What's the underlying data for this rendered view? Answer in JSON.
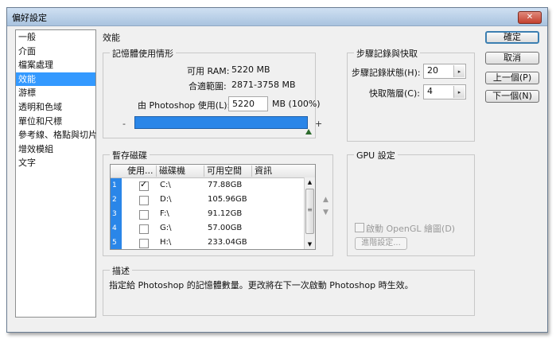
{
  "window": {
    "title": "偏好設定",
    "close_glyph": "✕"
  },
  "nav": {
    "items": [
      {
        "label": "一般"
      },
      {
        "label": "介面"
      },
      {
        "label": "檔案處理"
      },
      {
        "label": "效能",
        "selected": true
      },
      {
        "label": "游標"
      },
      {
        "label": "透明和色域"
      },
      {
        "label": "單位和尺標"
      },
      {
        "label": "參考線、格點與切片"
      },
      {
        "label": "增效模組"
      },
      {
        "label": "文字"
      }
    ]
  },
  "section_title": "效能",
  "memory": {
    "legend": "記憶體使用情形",
    "available_label": "可用 RAM:",
    "available_value": "5220 MB",
    "ideal_label": "合適範圍:",
    "ideal_value": "2871-3758 MB",
    "use_label": "由 Photoshop 使用(L):",
    "use_value": "5220",
    "use_unit": "MB (100%)",
    "minus": "-",
    "plus": "+",
    "usage_fraction": 1.0
  },
  "history": {
    "legend": "步驟記錄與快取",
    "states_label": "步驟記錄狀態(H):",
    "states_value": "20",
    "cache_label": "快取階層(C):",
    "cache_value": "4"
  },
  "buttons": {
    "ok": "確定",
    "cancel": "取消",
    "prev": "上一個(P)",
    "next": "下一個(N)"
  },
  "scratch": {
    "legend": "暫存磁碟",
    "headers": [
      "使用...",
      "磁碟機",
      "可用空間",
      "資訊"
    ],
    "rows": [
      {
        "num": "1",
        "checked": true,
        "drive": "C:\\",
        "free": "77.88GB",
        "info": ""
      },
      {
        "num": "2",
        "checked": false,
        "drive": "D:\\",
        "free": "105.96GB",
        "info": ""
      },
      {
        "num": "3",
        "checked": false,
        "drive": "F:\\",
        "free": "91.12GB",
        "info": ""
      },
      {
        "num": "4",
        "checked": false,
        "drive": "G:\\",
        "free": "57.00GB",
        "info": ""
      },
      {
        "num": "5",
        "checked": false,
        "drive": "H:\\",
        "free": "233.04GB",
        "info": ""
      }
    ],
    "up_arrow": "▲",
    "down_arrow": "▼"
  },
  "gpu": {
    "legend": "GPU 設定",
    "opengl_label": "啟動 OpenGL 繪圖(D)",
    "advanced_label": "進階設定..."
  },
  "description": {
    "legend": "描述",
    "text": "指定給 Photoshop 的記憶體數量。更改將在下一次啟動 Photoshop 時生效。"
  }
}
